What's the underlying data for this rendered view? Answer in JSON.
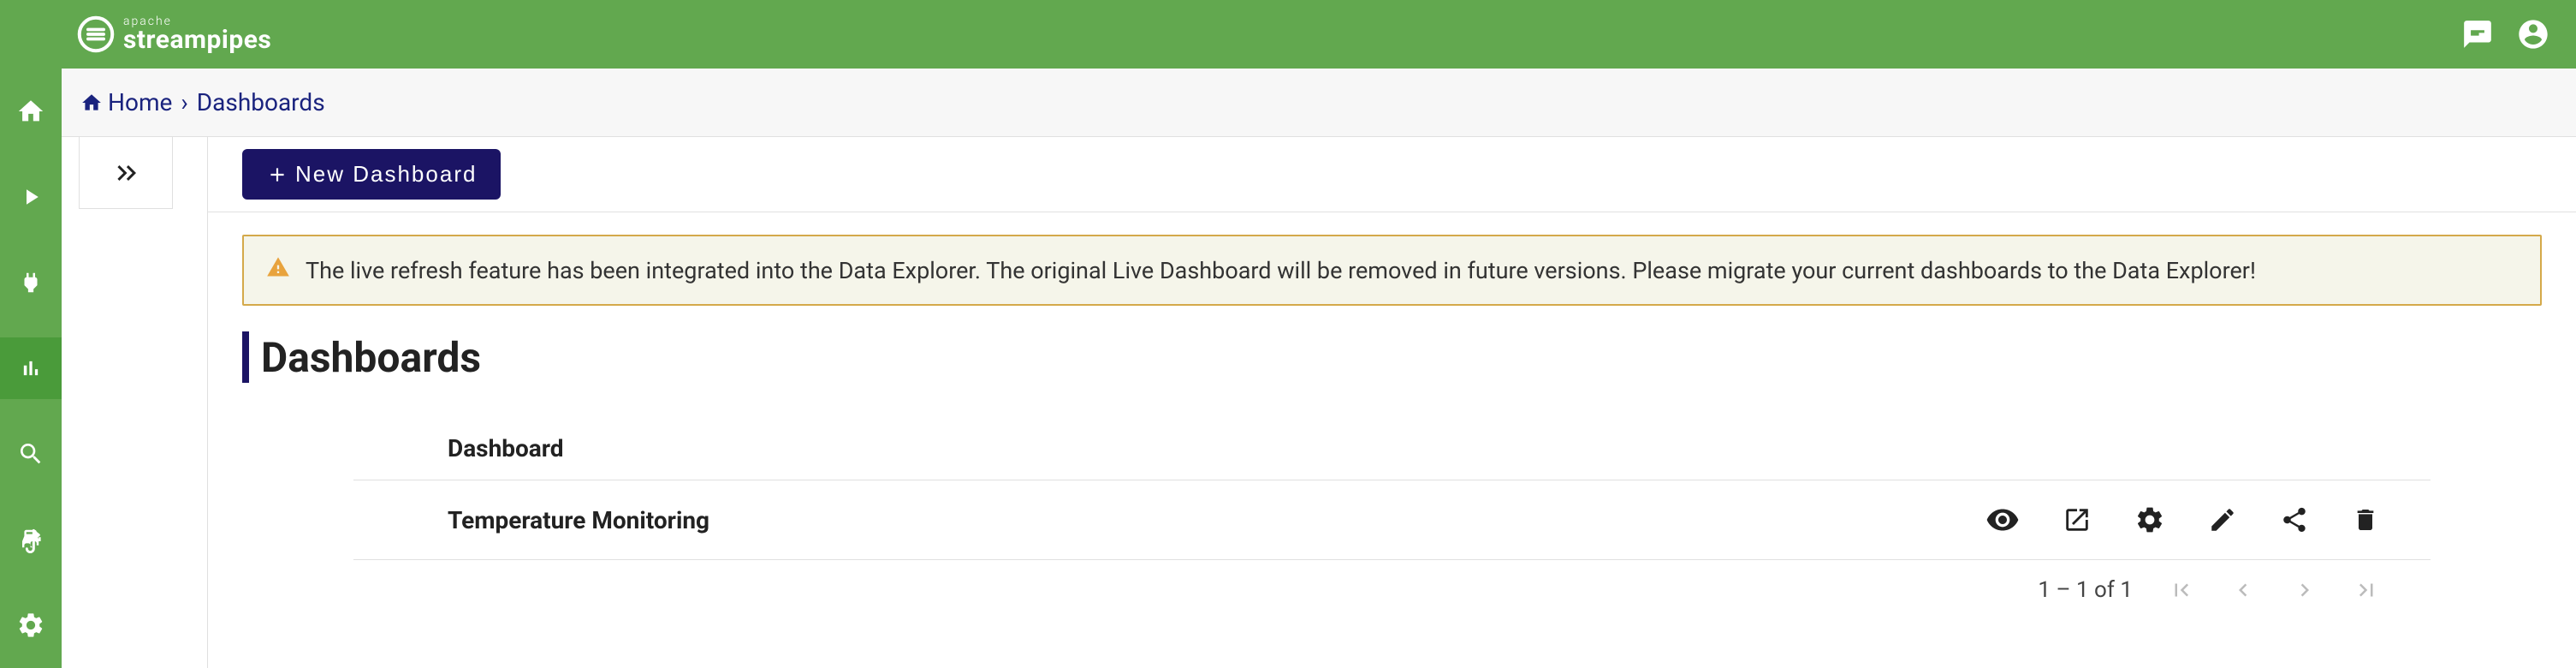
{
  "logo": {
    "apache": "apache",
    "name": "streampipes"
  },
  "breadcrumb": {
    "home": "Home",
    "current": "Dashboards"
  },
  "toolbar": {
    "newDashboard": "New Dashboard"
  },
  "warning": {
    "text": "The live refresh feature has been integrated into the Data Explorer. The original Live Dashboard will be removed in future versions. Please migrate your current dashboards to the Data Explorer!"
  },
  "section": {
    "title": "Dashboards"
  },
  "table": {
    "columnHeader": "Dashboard",
    "rows": [
      {
        "name": "Temperature Monitoring"
      }
    ]
  },
  "paginator": {
    "range": "1 – 1 of 1"
  }
}
